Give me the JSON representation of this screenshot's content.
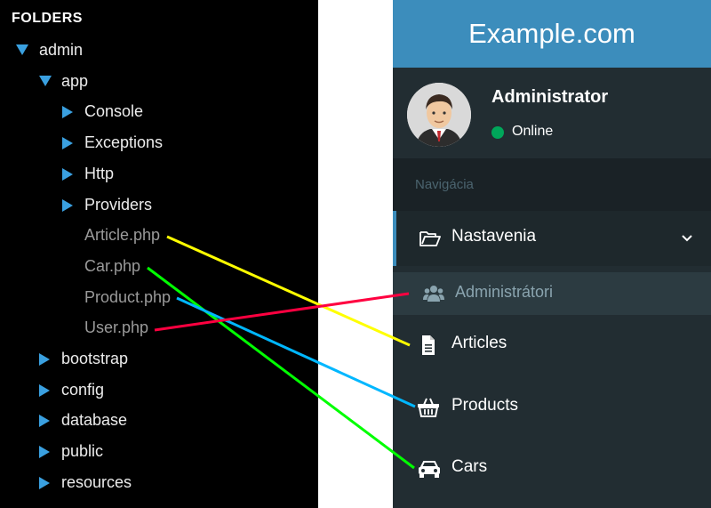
{
  "tree": {
    "header": "FOLDERS",
    "nodes": [
      {
        "label": "admin",
        "type": "folder",
        "state": "open",
        "depth": 0
      },
      {
        "label": "app",
        "type": "folder",
        "state": "open",
        "depth": 1
      },
      {
        "label": "Console",
        "type": "folder",
        "state": "closed",
        "depth": 2
      },
      {
        "label": "Exceptions",
        "type": "folder",
        "state": "closed",
        "depth": 2
      },
      {
        "label": "Http",
        "type": "folder",
        "state": "closed",
        "depth": 2
      },
      {
        "label": "Providers",
        "type": "folder",
        "state": "closed",
        "depth": 2
      },
      {
        "label": "Article.php",
        "type": "file",
        "depth": 2
      },
      {
        "label": "Car.php",
        "type": "file",
        "depth": 2
      },
      {
        "label": "Product.php",
        "type": "file",
        "depth": 2
      },
      {
        "label": "User.php",
        "type": "file",
        "depth": 2
      },
      {
        "label": "bootstrap",
        "type": "folder",
        "state": "closed",
        "depth": 1
      },
      {
        "label": "config",
        "type": "folder",
        "state": "closed",
        "depth": 1
      },
      {
        "label": "database",
        "type": "folder",
        "state": "closed",
        "depth": 1
      },
      {
        "label": "public",
        "type": "folder",
        "state": "closed",
        "depth": 1
      },
      {
        "label": "resources",
        "type": "folder",
        "state": "closed",
        "depth": 1
      }
    ]
  },
  "panel": {
    "brand": "Example.com",
    "user": {
      "name": "Administrator",
      "status": "Online",
      "avatar_icon": "user-avatar-icon"
    },
    "nav_header": "Navigácia",
    "menu": [
      {
        "label": "Nastavenia",
        "icon": "folder-open-icon",
        "kind": "active"
      },
      {
        "label": "Administrátori",
        "icon": "users-icon",
        "kind": "sub"
      },
      {
        "label": "Articles",
        "icon": "file-text-icon",
        "kind": "plain"
      },
      {
        "label": "Products",
        "icon": "shopping-basket-icon",
        "kind": "plain"
      },
      {
        "label": "Cars",
        "icon": "car-icon",
        "kind": "plain"
      }
    ]
  },
  "connectors": [
    {
      "from": "Article.php",
      "to": "Articles",
      "color": "#ffff00"
    },
    {
      "from": "Car.php",
      "to": "Cars",
      "color": "#00ff00"
    },
    {
      "from": "Product.php",
      "to": "Products",
      "color": "#00b7ff"
    },
    {
      "from": "User.php",
      "to": "Administrátori",
      "color": "#ff0040"
    }
  ],
  "colors": {
    "tree_bg": "#000000",
    "arrow": "#3aa0e0",
    "panel_bg": "#222d32",
    "header_bg": "#3c8dbc",
    "online": "#00a65a"
  }
}
